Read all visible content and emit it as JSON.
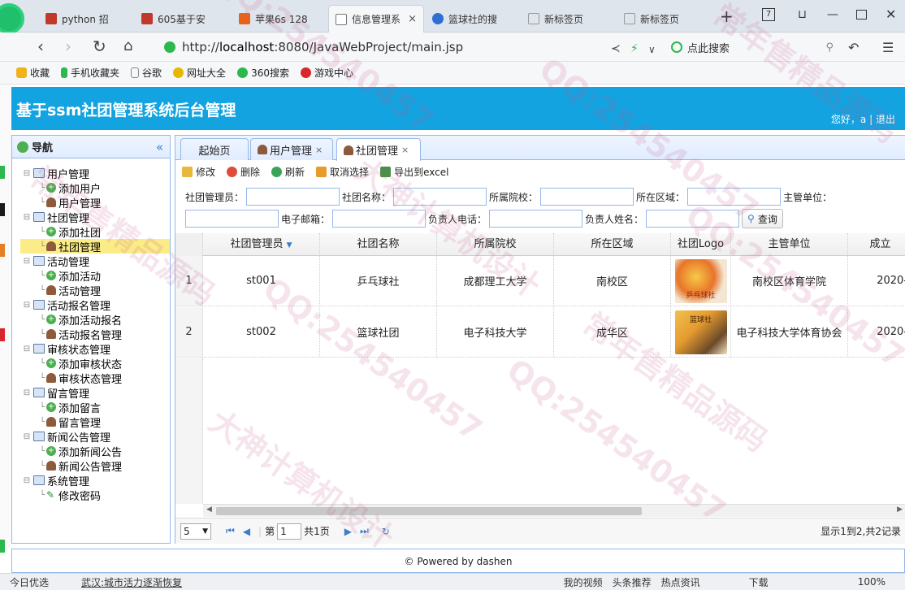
{
  "browser": {
    "tabs": [
      {
        "label": "python 招",
        "active": false,
        "icon": "site-icon"
      },
      {
        "label": "605基于安",
        "active": false,
        "icon": "site-icon"
      },
      {
        "label": "苹果6s 128",
        "active": false,
        "icon": "taobao-icon"
      },
      {
        "label": "信息管理系",
        "active": true,
        "icon": "document-icon"
      },
      {
        "label": "篮球社的搜",
        "active": false,
        "icon": "paw-icon"
      },
      {
        "label": "新标签页",
        "active": false,
        "icon": "grid-icon"
      },
      {
        "label": "新标签页",
        "active": false,
        "icon": "grid-icon"
      }
    ],
    "new_tab": "+",
    "tab_close": "×",
    "url_prefix": "http://",
    "url_host": "localhost",
    "url_path": ":8080/JavaWebProject/main.jsp",
    "search_placeholder": "点此搜索",
    "bookmarks": [
      {
        "label": "收藏",
        "icon": "star-icon"
      },
      {
        "label": "手机收藏夹",
        "icon": "phone-icon"
      },
      {
        "label": "谷歌",
        "icon": "page-icon"
      },
      {
        "label": "网址大全",
        "icon": "globe-icon"
      },
      {
        "label": "360搜索",
        "icon": "search-icon"
      },
      {
        "label": "游戏中心",
        "icon": "game-icon"
      }
    ]
  },
  "app": {
    "title": "基于ssm社团管理系统后台管理",
    "greeting": "您好，a",
    "separator": "|",
    "logout": "退出"
  },
  "nav": {
    "title": "导航",
    "collapse": "«",
    "groups": [
      {
        "label": "用户管理",
        "children": [
          "添加用户",
          "用户管理"
        ]
      },
      {
        "label": "社团管理",
        "children": [
          "添加社团",
          "社团管理"
        ]
      },
      {
        "label": "活动管理",
        "children": [
          "添加活动",
          "活动管理"
        ]
      },
      {
        "label": "活动报名管理",
        "children": [
          "添加活动报名",
          "活动报名管理"
        ]
      },
      {
        "label": "审核状态管理",
        "children": [
          "添加审核状态",
          "审核状态管理"
        ]
      },
      {
        "label": "留言管理",
        "children": [
          "添加留言",
          "留言管理"
        ]
      },
      {
        "label": "新闻公告管理",
        "children": [
          "添加新闻公告",
          "新闻公告管理"
        ]
      },
      {
        "label": "系统管理",
        "children": [
          "修改密码"
        ]
      }
    ],
    "selected": "社团管理"
  },
  "tabs": [
    {
      "label": "起始页",
      "closable": false
    },
    {
      "label": "用户管理",
      "closable": true
    },
    {
      "label": "社团管理",
      "closable": true,
      "active": true
    }
  ],
  "toolbar": {
    "edit": "修改",
    "delete": "删除",
    "refresh": "刷新",
    "cancel_select": "取消选择",
    "export": "导出到excel"
  },
  "filters": {
    "row1": [
      "社团管理员：",
      "社团名称：",
      "所属院校：",
      "所在区域：",
      "主管单位："
    ],
    "row2": [
      "电子邮箱：",
      "负责人电话：",
      "负责人姓名："
    ],
    "query": "查询"
  },
  "grid": {
    "columns": [
      "社团管理员",
      "社团名称",
      "所属院校",
      "所在区域",
      "社团Logo",
      "主管单位",
      "成立"
    ],
    "rows": [
      {
        "num": "1",
        "admin": "st001",
        "name": "乒乓球社",
        "school": "成都理工大学",
        "area": "南校区",
        "logo": "乒乓球社",
        "unit": "南校区体育学院",
        "date": "2020-"
      },
      {
        "num": "2",
        "admin": "st002",
        "name": "篮球社团",
        "school": "电子科技大学",
        "area": "成华区",
        "logo": "篮球社",
        "unit": "电子科技大学体育协会",
        "date": "2020-"
      }
    ]
  },
  "pager": {
    "page_size": "5",
    "page_prefix": "第",
    "page_value": "1",
    "page_suffix": "共1页",
    "summary": "显示1到2,共2记录"
  },
  "footer": "© Powered by dashen",
  "statusbar": {
    "left": [
      "今日优选",
      "武汉:城市活力逐渐恢复"
    ],
    "right": [
      "我的视频",
      "头条推荐",
      "热点资讯",
      "下载",
      "100%"
    ]
  },
  "watermark": {
    "lines": [
      "QQ:254540457",
      "大神计算机设计",
      "常年售精品源码"
    ],
    "color": "#c85a8c"
  },
  "colors": {
    "header_bg": "#13a3e0",
    "panel_border": "#95b8e7",
    "selected_row": "#fbec88"
  }
}
